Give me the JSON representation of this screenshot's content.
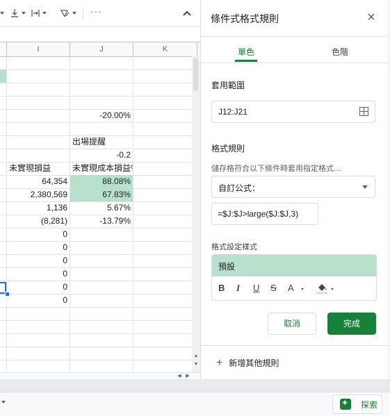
{
  "sheet": {
    "columns": [
      "I",
      "J",
      "K"
    ],
    "rows": [
      {
        "h": "",
        "i": "",
        "j": "",
        "jgreen": false
      },
      {
        "h": "",
        "i": "",
        "j": "",
        "jgreen": false,
        "hgreen": true
      },
      {
        "h": "",
        "i": "",
        "j": "",
        "jgreen": false
      },
      {
        "h": "",
        "i": "",
        "j": "",
        "jgreen": false
      },
      {
        "h": "",
        "i": "",
        "j": "-20.00%",
        "jgreen": false
      },
      {
        "h": "",
        "i": "",
        "j": "",
        "jgreen": false
      },
      {
        "h": "",
        "i": "",
        "j": "出場提醒",
        "jgreen": false,
        "jleft": true
      },
      {
        "h": "",
        "i": "",
        "j": "-0.2",
        "jgreen": false
      },
      {
        "h": "",
        "i": "未實現損益",
        "j": "未實現成本損益%",
        "jgreen": false,
        "ileft": true,
        "jleft": true
      },
      {
        "h": "",
        "i": "64,354",
        "j": "88.08%",
        "jgreen": true
      },
      {
        "h": "",
        "i": "2,380,569",
        "j": "67.83%",
        "jgreen": true
      },
      {
        "h": "",
        "i": "1,136",
        "j": "5.67%",
        "jgreen": false
      },
      {
        "h": "",
        "i": "(8,281)",
        "j": "-13.79%",
        "jgreen": false
      },
      {
        "h": "",
        "i": "0",
        "j": "",
        "jgreen": false
      },
      {
        "h": "",
        "i": "0",
        "j": "",
        "jgreen": false
      },
      {
        "h": "",
        "i": "0",
        "j": "",
        "jgreen": false
      },
      {
        "h": "",
        "i": "0",
        "j": "",
        "jgreen": false
      },
      {
        "h": "",
        "i": "0",
        "j": "",
        "jgreen": false
      },
      {
        "h": "",
        "i": "0",
        "j": "",
        "jgreen": false
      },
      {
        "h": "",
        "i": "",
        "j": "",
        "jgreen": false
      },
      {
        "h": "",
        "i": "",
        "j": "",
        "jgreen": false
      },
      {
        "h": "",
        "i": "",
        "j": "",
        "jgreen": false
      },
      {
        "h": "",
        "i": "",
        "j": "",
        "jgreen": false
      },
      {
        "h": "",
        "i": "",
        "j": "",
        "jgreen": false
      }
    ]
  },
  "panel": {
    "title": "條件式格式規則",
    "tabs": {
      "single": "單色",
      "scale": "色階"
    },
    "range_label": "套用範圍",
    "range_value": "J12:J21",
    "rules_label": "格式規則",
    "rules_hint": "儲存格符合以下條件時套用指定格式…",
    "condition": "自訂公式：",
    "formula": "=$J:$J>large($J:$J,3)",
    "style_label": "格式設定樣式",
    "style_preview": "預設",
    "style_tools": {
      "bold": "B",
      "italic": "I",
      "underline": "U",
      "strike": "S",
      "text_color": "A"
    },
    "cancel": "取消",
    "done": "完成",
    "add_rule": "新增其他規則"
  },
  "explore": "探索",
  "colors": {
    "accent": "#188038",
    "highlight": "#b7e1cd"
  }
}
